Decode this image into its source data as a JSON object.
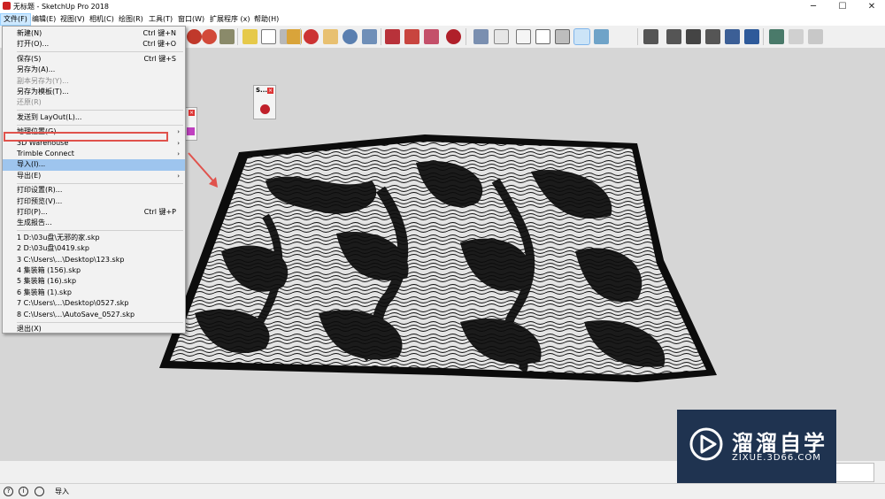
{
  "window": {
    "title": "无标题 - SketchUp Pro 2018",
    "minimize_glyph": "─",
    "maximize_glyph": "☐",
    "close_glyph": "✕"
  },
  "menubar": {
    "items": [
      {
        "label": "文件(F)",
        "active": true
      },
      {
        "label": "编辑(E)"
      },
      {
        "label": "视图(V)"
      },
      {
        "label": "相机(C)"
      },
      {
        "label": "绘图(R)"
      },
      {
        "label": "工具(T)"
      },
      {
        "label": "窗口(W)"
      },
      {
        "label": "扩展程序 (x)"
      },
      {
        "label": "帮助(H)"
      }
    ]
  },
  "file_menu": {
    "items": [
      {
        "label": "新建(N)",
        "shortcut": "Ctrl 键+N"
      },
      {
        "label": "打开(O)...",
        "shortcut": "Ctrl 键+O"
      },
      {
        "separator": true
      },
      {
        "label": "保存(S)",
        "shortcut": "Ctrl 键+S"
      },
      {
        "label": "另存为(A)..."
      },
      {
        "label": "副本另存为(Y)...",
        "disabled": true
      },
      {
        "label": "另存为模板(T)..."
      },
      {
        "label": "还原(R)",
        "disabled": true
      },
      {
        "separator": true
      },
      {
        "label": "发送到 LayOut(L)..."
      },
      {
        "separator": true
      },
      {
        "label": "地理位置(G)",
        "submenu": true
      },
      {
        "label": "3D Warehouse",
        "submenu": true
      },
      {
        "label": "Trimble Connect",
        "submenu": true
      },
      {
        "label": "导入(I)...",
        "highlighted": true
      },
      {
        "label": "导出(E)",
        "submenu": true
      },
      {
        "separator": true
      },
      {
        "label": "打印设置(R)..."
      },
      {
        "label": "打印预览(V)..."
      },
      {
        "label": "打印(P)...",
        "shortcut": "Ctrl 键+P"
      },
      {
        "label": "生成报告..."
      },
      {
        "separator": true
      },
      {
        "label": "1 D:\\03u盘\\无邪的家.skp"
      },
      {
        "label": "2 D:\\03u盘\\0419.skp"
      },
      {
        "label": "3 C:\\Users\\...\\Desktop\\123.skp"
      },
      {
        "label": "4 集装箱 (156).skp"
      },
      {
        "label": "5 集装箱 (16).skp"
      },
      {
        "label": "6 集装箱 (1).skp"
      },
      {
        "label": "7 C:\\Users\\...\\Desktop\\0527.skp"
      },
      {
        "label": "8 C:\\Users\\...\\AutoSave_0527.skp"
      },
      {
        "separator": true
      },
      {
        "label": "退出(X)"
      }
    ],
    "submenu_arrow": "›"
  },
  "floating_panel": {
    "title": "S..."
  },
  "statusbar": {
    "text": "导入",
    "icon1": "?",
    "icon2": "i"
  },
  "watermark": {
    "brand": "溜溜自学",
    "url": "ZIXUE.3D66.COM"
  },
  "toolbar": {
    "icons": [
      "pencil-icon",
      "text-icon",
      "dimension-icon",
      "paint-icon",
      "orbit-icon",
      "pan-icon",
      "zoom-icon",
      "zoom-extents-icon",
      "warehouse-icon",
      "extension-warehouse-icon",
      "layout-icon",
      "ruby-icon",
      "iso-view-icon",
      "top-view-icon",
      "front-view-icon",
      "right-view-icon",
      "back-view-icon",
      "left-view-icon",
      "bottom-view-icon",
      "xray-icon",
      "wireframe-icon",
      "hidden-line-icon",
      "shaded-icon",
      "textured-icon",
      "monochrome-icon",
      "model-info-icon",
      "sandbox-from-contours-icon",
      "sandbox-stamp-icon"
    ]
  },
  "colors": {
    "viewport": "#d6d6d6",
    "menu_highlight": "#9ec5ee",
    "annotation_red": "#e0524c",
    "watermark_bg": "#1f3350"
  }
}
